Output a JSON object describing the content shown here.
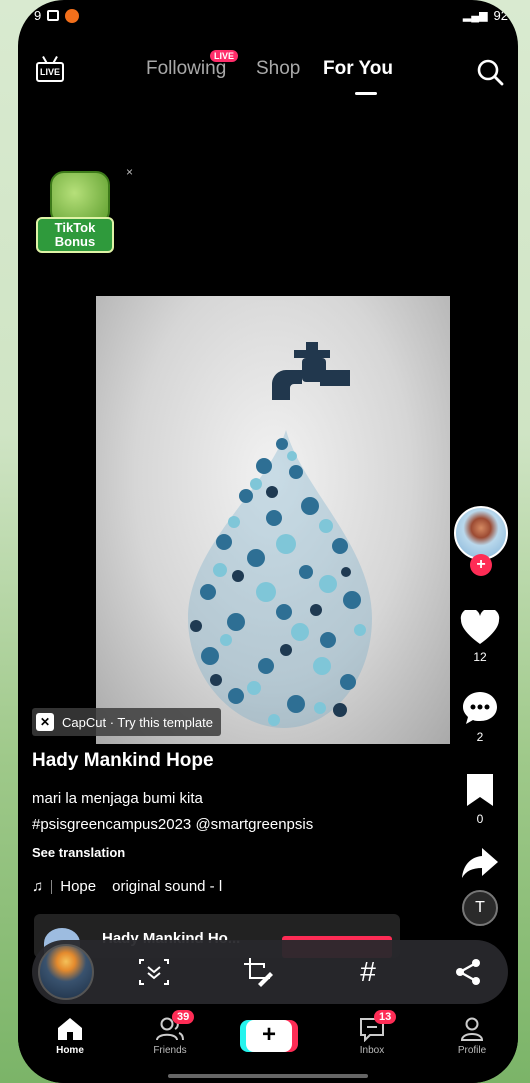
{
  "status_bar": {
    "time": "9",
    "battery": "92"
  },
  "top_nav": {
    "live_label": "LIVE",
    "tabs": [
      {
        "label": "Following",
        "badge": "LIVE"
      },
      {
        "label": "Shop"
      },
      {
        "label": "For You",
        "active": true
      }
    ]
  },
  "bonus": {
    "label_line1": "TikTok",
    "label_line2": "Bonus",
    "close": "×"
  },
  "video": {
    "capcut_label": "CapCut · Try this template",
    "author": "Hady Mankind Hope",
    "caption_line1": "mari la menjaga bumi kita",
    "caption_line2": "#psisgreencampus2023 @smartgreenpsis",
    "see_translation": "See translation",
    "music_name": "Hope",
    "music_sound": "original sound - l"
  },
  "actions": {
    "likes": "12",
    "comments": "2",
    "saves": "0",
    "follow_plus": "+"
  },
  "music_card": {
    "title": "Hady Mankind Ho..."
  },
  "text_tool": "T",
  "toolbar": {
    "hashtag": "#"
  },
  "bottom_nav": {
    "home": "Home",
    "friends": "Friends",
    "friends_badge": "39",
    "create": "+",
    "inbox": "Inbox",
    "inbox_badge": "13",
    "profile": "Profile"
  },
  "colors": {
    "accent_red": "#fe2c55",
    "accent_cyan": "#25f4ee",
    "background": "#000000"
  }
}
